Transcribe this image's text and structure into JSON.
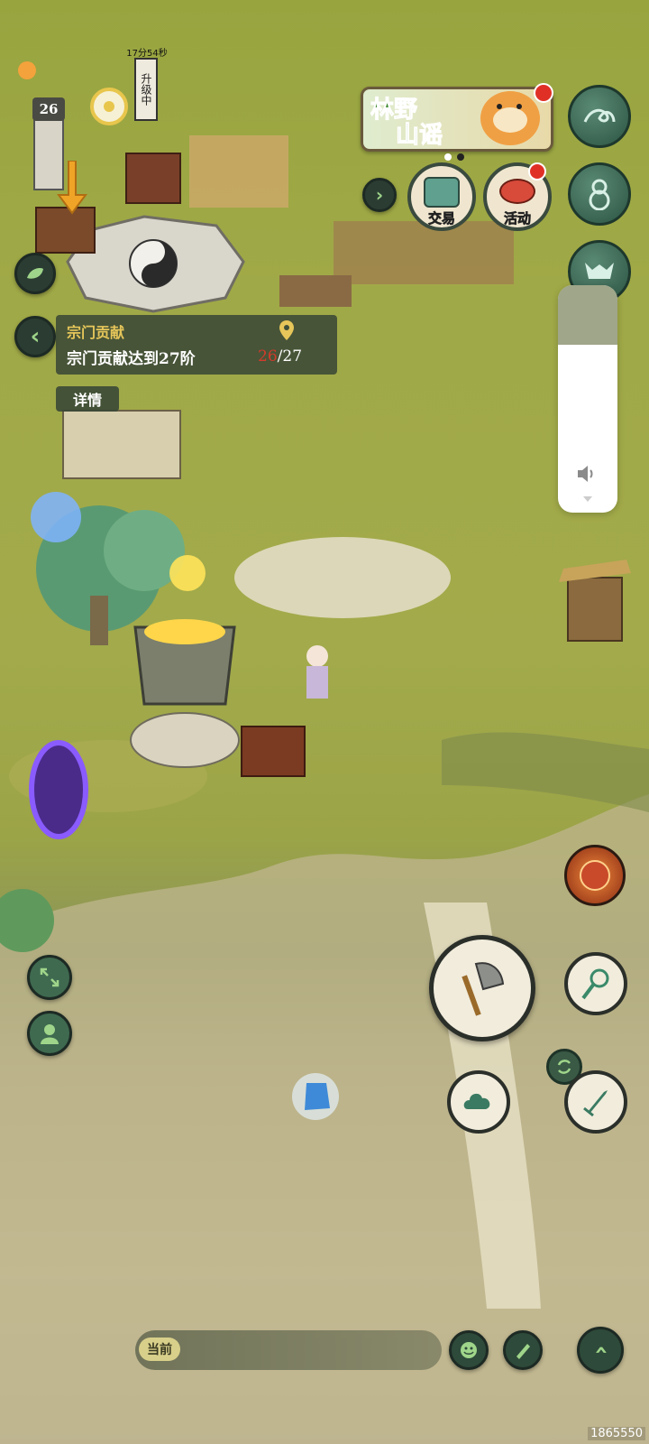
{
  "hud": {
    "level_badge": "26",
    "upgrade_timer": "17分54秒",
    "upgrade_status": "升级中",
    "banner_title_line1": "林野",
    "banner_title_line2": "山谣"
  },
  "top_buttons": [
    {
      "label": "交易",
      "icon": "trade-icon"
    },
    {
      "label": "活动",
      "icon": "drum-icon",
      "has_notification": true
    }
  ],
  "quest": {
    "title": "宗门贡献",
    "description": "宗门贡献达到27阶",
    "progress_current": "26",
    "progress_sep": "/",
    "progress_total": "27",
    "details_label": "详情"
  },
  "bottom": {
    "current_label": "当前",
    "watermark": "1865550"
  },
  "side_icons_right": [
    "wave-icon",
    "gourd-icon",
    "demon-mask-icon",
    "flame-face-icon",
    "axe-icon",
    "net-icon",
    "cloud-icon",
    "sword-icon",
    "swap-icon",
    "chevron-up-icon"
  ],
  "side_icons_left": [
    "leaf-icon",
    "back-icon",
    "expand-icon",
    "character-icon"
  ],
  "colors": {
    "accent_gold": "#e6c65a",
    "progress_red": "#d23a2a",
    "panel_bg": "#3e4f3a"
  }
}
